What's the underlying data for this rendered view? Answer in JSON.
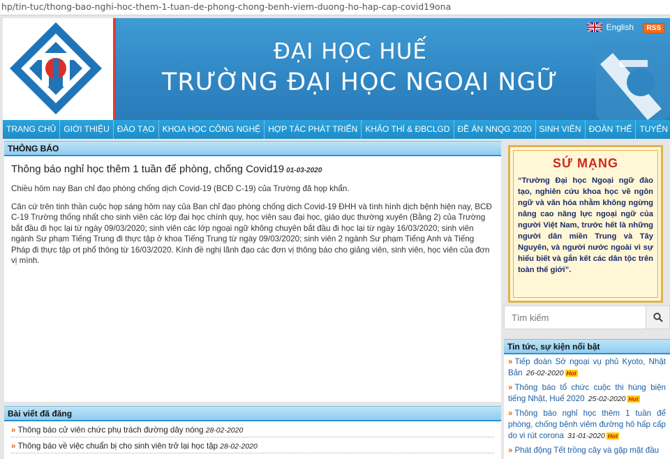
{
  "browser": {
    "url": "hp/tin-tuc/thong-bao-nghi-hoc-them-1-tuan-de-phong-chong-benh-viem-duong-ho-hap-cap-covid19ona"
  },
  "header": {
    "title_line1": "ĐẠI HỌC HUẾ",
    "title_line2": "TRƯỜNG ĐẠI HỌC NGOẠI NGỮ",
    "language_label": "English",
    "rss_label": "RSS"
  },
  "nav": {
    "items": [
      "TRANG CHỦ",
      "GIỚI THIỆU",
      "ĐÀO TẠO",
      "KHOA HỌC CÔNG NGHỆ",
      "HỢP TÁC PHÁT TRIỂN",
      "KHẢO THÍ & ĐBCLGD",
      "ĐỀ ÁN NNQG 2020",
      "SINH VIÊN",
      "ĐOÀN THỂ",
      "TUYỂN SINH"
    ]
  },
  "main": {
    "section_title": "THÔNG BÁO",
    "article": {
      "title": "Thông báo nghỉ học thêm 1 tuần để phòng, chống Covid19",
      "date": "01-03-2020",
      "paragraph1": "Chiều hôm nay Ban chỉ đạo phòng chống dịch Covid-19 (BCĐ C-19) của Trường đã họp khẩn.",
      "paragraph2": "Căn cứ trên tinh thần cuộc họp sáng hôm nay của Ban chỉ đạo phòng chống dịch Covid-19 ĐHH và tình hình dịch bệnh hiện nay, BCĐ C-19 Trường thống nhất cho sinh viên các lớp đại học chính quy, học viên sau đại học, giáo dục thường xuyên (Bằng 2) của Trường bắt đầu đi học lại từ ngày 09/03/2020; sinh viên các lớp ngoại ngữ không chuyên bắt đầu đi học lại từ ngày 16/03/2020; sinh viên ngành Sư phạm Tiếng Trung đi thực tập ở khoa Tiếng Trung từ ngày 09/03/2020; sinh viên 2 ngành Sư phạm Tiếng Anh và Tiếng Pháp đi thực tập ơt phổ thông từ 16/03/2020. Kính đề nghị lãnh đạo các đơn vị thông báo cho giảng viên, sinh viên, học viên của đơn vị mình."
    }
  },
  "posted": {
    "section_title": "Bài viết đã đăng",
    "items": [
      {
        "title": "Thông báo cử viên chức phụ trách đường dây nóng",
        "date": "28-02-2020"
      },
      {
        "title": "Thông báo về việc chuẩn bị cho sinh viên trở lại học tập",
        "date": "28-02-2020"
      }
    ]
  },
  "sidebar": {
    "mission_title": "SỨ MẠNG",
    "mission_text": "“Trường Đại học Ngoại ngữ đào tạo, nghiên cứu khoa học về ngôn ngữ và văn hóa nhằm không ngừng nâng cao năng lực ngoại ngữ của người Việt Nam, trước hết là những người dân miền Trung và Tây Nguyên, và người nước ngoài vì sự hiểu biết và gắn kết các dân tộc trên toàn thế giới”.",
    "search_placeholder": "Tìm kiếm",
    "news_title": "Tin tức, sự kiện nổi bật",
    "hot_label": "Hot",
    "news_items": [
      {
        "title": "Tiếp đoàn Sở ngoại vụ phủ Kyoto, Nhật Bản",
        "date": "26-02-2020"
      },
      {
        "title": "Thông báo tổ chức cuộc thi hùng biện tiếng Nhật, Huế 2020",
        "date": "25-02-2020"
      },
      {
        "title": "Thông báo nghỉ học thêm 1 tuần để phòng, chống bệnh viêm đường hô hấp cấp do vi rút corona",
        "date": "31-01-2020"
      },
      {
        "title": "Phát động Tết trồng cây và gặp mặt đầu",
        "date": ""
      }
    ]
  },
  "colors": {
    "banner_blue": "#2f86c3",
    "nav_blue": "#1e8cc9",
    "accent_orange": "#e06a1a",
    "mission_red": "#d0281c",
    "link_blue": "#1a5ea6"
  }
}
